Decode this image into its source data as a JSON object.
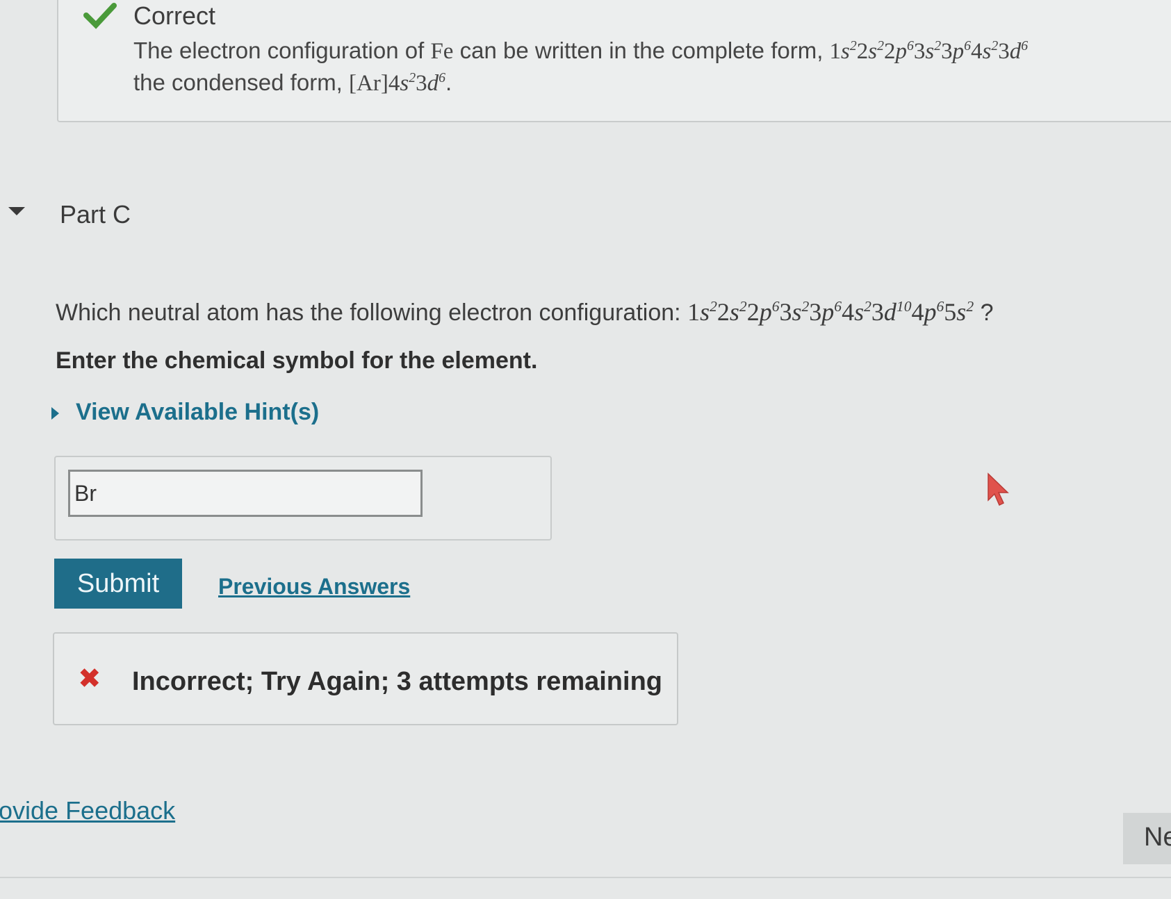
{
  "correct_feedback": {
    "title": "Correct",
    "line1_prefix": "The electron configuration of",
    "element": "Fe",
    "line1_middle": "can be written in the complete form,",
    "line2_prefix": "the condensed form,",
    "noble_gas": "Ar"
  },
  "part": {
    "title": "Part C",
    "question_prefix": "Which neutral atom has the following electron configuration:",
    "question_suffix": "?",
    "instruction": "Enter the chemical symbol for the element."
  },
  "hints": {
    "label": "View Available Hint(s)"
  },
  "answer": {
    "value": "Br"
  },
  "actions": {
    "submit_label": "Submit",
    "previous_answers_label": "Previous Answers"
  },
  "result": {
    "message": "Incorrect; Try Again; 3 attempts remaining"
  },
  "footer": {
    "feedback_label": "ovide Feedback",
    "next_label": "Ne"
  },
  "colors": {
    "accent": "#1f6d89",
    "link": "#1c6f8c",
    "correct": "#4a9a3a",
    "error": "#d3302a"
  },
  "icons": {
    "correct": "check-icon",
    "incorrect": "x-icon",
    "pointer": "cursor-icon"
  }
}
